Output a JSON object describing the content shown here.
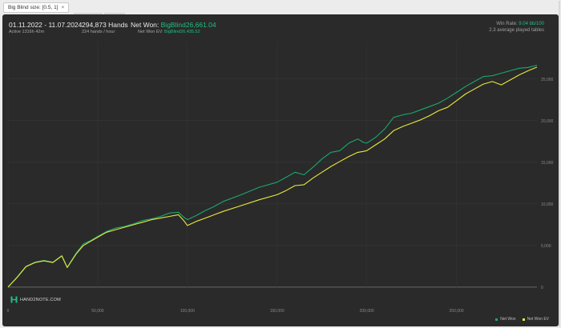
{
  "filter": {
    "label": "Big Blind size: [0.5, 1]",
    "close_label": "×"
  },
  "header": {
    "date_range": "01.11.2022 - 11.07.2024",
    "active": "Active 1316h 42m",
    "hands": "294,873 Hands",
    "hands_per_hour": "224 hands / hour",
    "net_won_label": "Net Won: ",
    "net_won_value": "BigBlind26,661.04",
    "net_won_ev_label": "Net Won  EV: ",
    "net_won_ev_value": "BigBlind26,435.52",
    "win_rate_label": "Win Rate: ",
    "win_rate_value": "9.04 bb/100",
    "avg_tables": "2.3 average played tables"
  },
  "logo": {
    "text": "HAND2NOTE.COM",
    "icon": "hand2note-logo-icon"
  },
  "colors": {
    "net_won": "#1aa86e",
    "net_won_ev": "#e9e93f",
    "accent_green": "#1fbf83"
  },
  "chart_data": {
    "type": "line",
    "title": "",
    "xlabel": "",
    "ylabel": "",
    "xlim": [
      0,
      294873
    ],
    "ylim": [
      -200,
      29500
    ],
    "x_ticks": [
      0,
      50000,
      100000,
      150000,
      200000,
      250000
    ],
    "x_tick_labels": [
      "0",
      "50,000",
      "100,000",
      "150,000",
      "200,000",
      "250,000"
    ],
    "y_ticks": [
      0,
      5000,
      10000,
      15000,
      20000,
      25000
    ],
    "y_tick_labels": [
      "0",
      "5,000",
      "10,000",
      "15,000",
      "20,000",
      "25,000"
    ],
    "grid": true,
    "legend_position": "bottom-right",
    "series": [
      {
        "name": "Net Won",
        "x": [
          0,
          5000,
          10000,
          15000,
          20000,
          25000,
          30000,
          33000,
          38000,
          42000,
          46000,
          50000,
          55000,
          60000,
          65000,
          70000,
          75000,
          80000,
          85000,
          90000,
          95000,
          98000,
          100000,
          105000,
          110000,
          115000,
          120000,
          130000,
          140000,
          150000,
          155000,
          160000,
          165000,
          170000,
          175000,
          180000,
          185000,
          190000,
          195000,
          198000,
          200000,
          205000,
          210000,
          215000,
          220000,
          225000,
          230000,
          235000,
          240000,
          245000,
          250000,
          255000,
          260000,
          265000,
          270000,
          275000,
          280000,
          285000,
          290000,
          294873
        ],
        "y": [
          0,
          1200,
          2500,
          3000,
          3200,
          3000,
          3800,
          2400,
          4100,
          5200,
          5600,
          6100,
          6700,
          7100,
          7300,
          7600,
          8000,
          8200,
          8500,
          8900,
          9000,
          8400,
          8100,
          8600,
          9200,
          9700,
          10300,
          11100,
          12000,
          12600,
          13200,
          13800,
          13500,
          14400,
          15400,
          16200,
          16400,
          17300,
          17800,
          17400,
          17300,
          18000,
          19000,
          20400,
          20700,
          20900,
          21300,
          21700,
          22100,
          22700,
          23400,
          24100,
          24700,
          25300,
          25400,
          25700,
          26000,
          26300,
          26400,
          26661
        ]
      },
      {
        "name": "Net Won  EV",
        "x": [
          0,
          5000,
          10000,
          15000,
          20000,
          25000,
          30000,
          33000,
          38000,
          42000,
          46000,
          50000,
          55000,
          60000,
          65000,
          70000,
          75000,
          80000,
          85000,
          90000,
          95000,
          98000,
          100000,
          105000,
          110000,
          115000,
          120000,
          130000,
          140000,
          150000,
          155000,
          160000,
          165000,
          170000,
          175000,
          180000,
          185000,
          190000,
          195000,
          198000,
          200000,
          205000,
          210000,
          215000,
          220000,
          225000,
          230000,
          235000,
          240000,
          245000,
          250000,
          255000,
          260000,
          265000,
          270000,
          275000,
          280000,
          285000,
          290000,
          294873
        ],
        "y": [
          0,
          1150,
          2450,
          2950,
          3150,
          2950,
          3750,
          2350,
          4000,
          5000,
          5500,
          6000,
          6600,
          6900,
          7200,
          7500,
          7800,
          8100,
          8300,
          8500,
          8700,
          8000,
          7400,
          7900,
          8300,
          8700,
          9100,
          9800,
          10500,
          11100,
          11600,
          12200,
          12300,
          13100,
          13800,
          14500,
          15100,
          15700,
          16200,
          16300,
          16400,
          17100,
          17800,
          18800,
          19300,
          19700,
          20100,
          20600,
          21200,
          21600,
          22400,
          23200,
          23800,
          24400,
          24700,
          24300,
          24900,
          25500,
          26000,
          26436
        ]
      }
    ]
  }
}
